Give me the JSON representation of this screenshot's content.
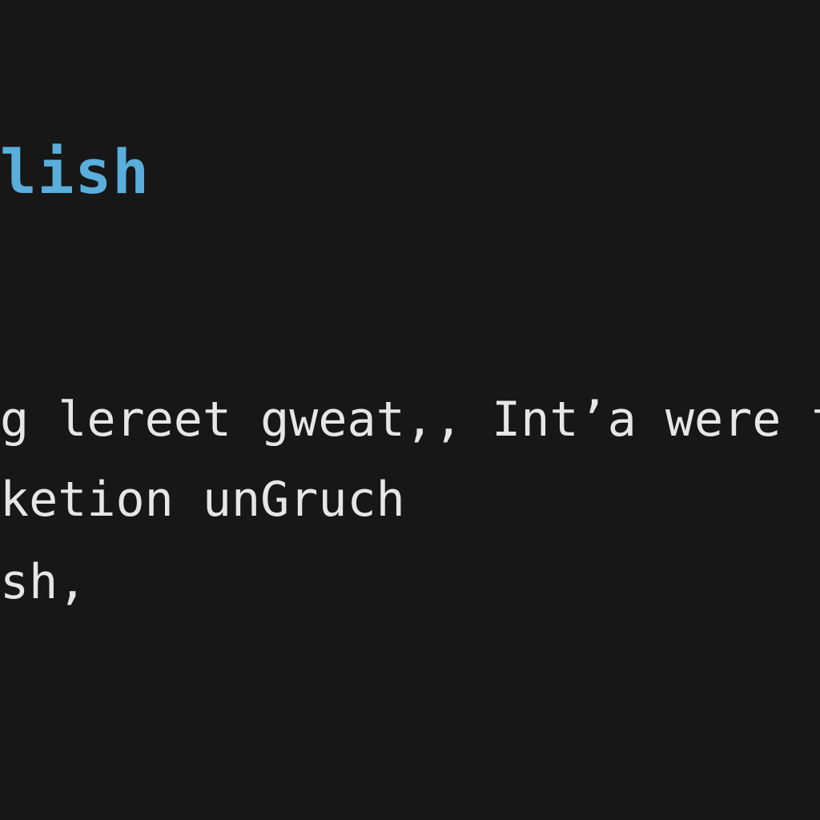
{
  "editor": {
    "background_color": "#171717",
    "heading_color": "#5aaedc",
    "text_color": "#e6e6e6",
    "heading_text": "lish",
    "lines": [
      "g lereet gweat,, Int’a were fo",
      "keti­on unGruch",
      "sh,"
    ]
  }
}
